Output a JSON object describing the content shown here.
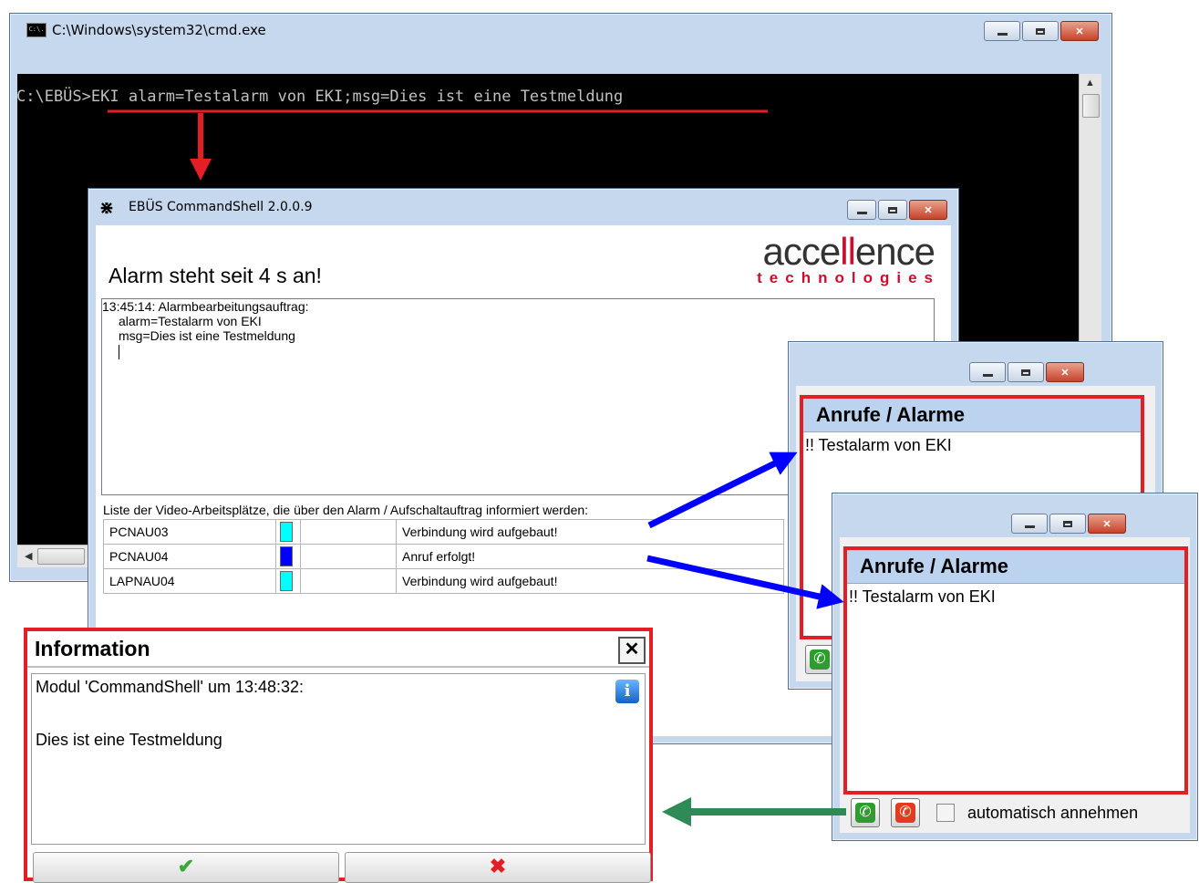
{
  "cmd_window": {
    "title": "C:\\Windows\\system32\\cmd.exe",
    "icon_text": "C:\\.",
    "prompt": "C:\\EBÜS>",
    "command": "EKI alarm=Testalarm von EKI;msg=Dies ist eine Testmeldung"
  },
  "shell_window": {
    "title": "EBÜS CommandShell 2.0.0.9",
    "heading": "Alarm steht seit 4 s an!",
    "logo_line1": "accellence",
    "logo_line2": "technologies",
    "log_lines": [
      "13:45:14: Alarmbearbeitungsauftrag:",
      "alarm=Testalarm von EKI",
      "msg=Dies ist eine Testmeldung"
    ],
    "list_label": "Liste der Video-Arbeitsplätze, die über den Alarm / Aufschaltauftrag informiert werden:",
    "workstations": [
      {
        "name": "PCNAU03",
        "color": "#00ffff",
        "status": "Verbindung wird aufgebaut!"
      },
      {
        "name": "PCNAU04",
        "color": "#0000ff",
        "status": "Anruf erfolgt!"
      },
      {
        "name": "LAPNAU04",
        "color": "#00ffff",
        "status": "Verbindung wird aufgebaut!"
      }
    ]
  },
  "alarm_window_1": {
    "header": "Anrufe / Alarme",
    "item": "!! Testalarm von EKI"
  },
  "alarm_window_2": {
    "header": "Anrufe / Alarme",
    "item": "!! Testalarm von EKI",
    "auto_accept_label": "automatisch annehmen"
  },
  "info_popup": {
    "title": "Information",
    "close_label": "✕",
    "line1": "Modul 'CommandShell' um 13:48:32:",
    "line2": "Dies ist eine Testmeldung",
    "ok_symbol": "✔",
    "cancel_symbol": "✖"
  },
  "colors": {
    "highlight_red": "#e31e24",
    "arrow_blue": "#0000ff",
    "arrow_green": "#2e8b57",
    "brand_red": "#c8102e"
  }
}
